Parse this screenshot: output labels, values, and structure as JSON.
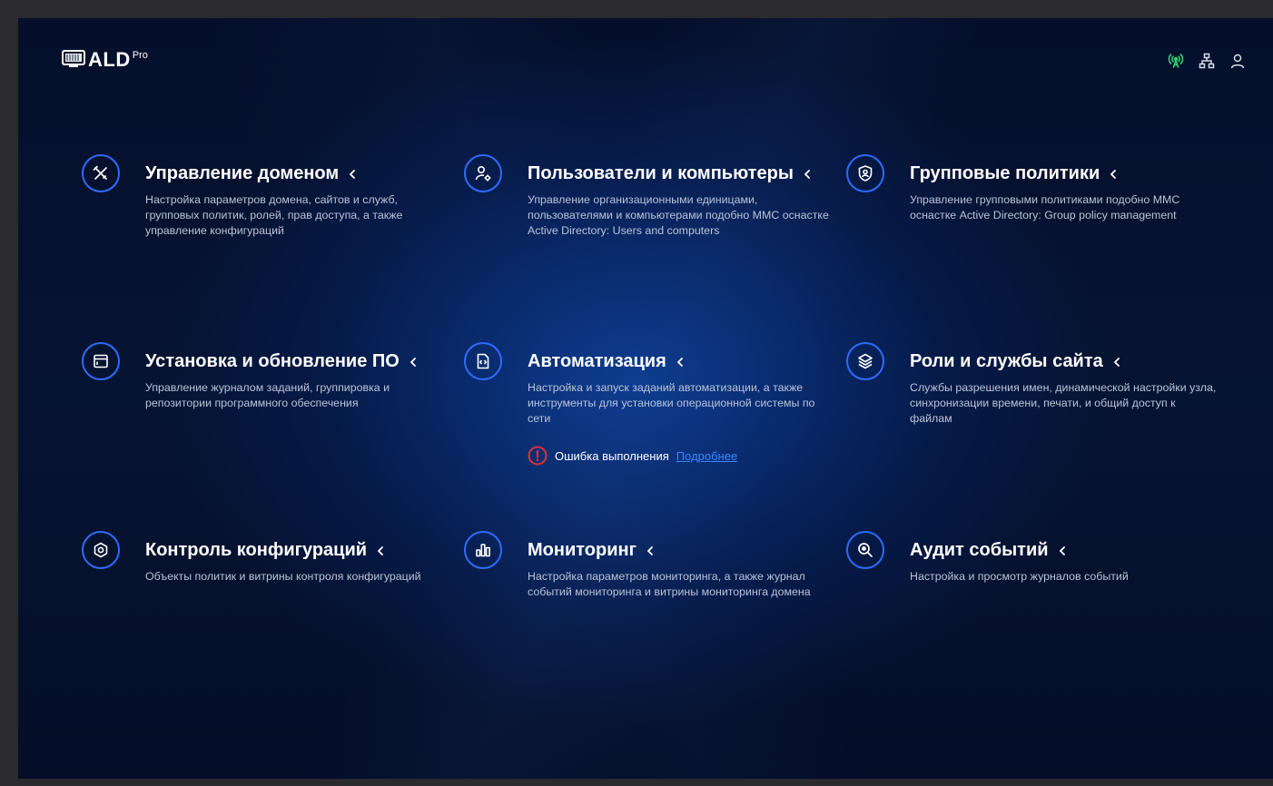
{
  "brand": {
    "name": "ALD",
    "suffix": "Pro"
  },
  "header_icons": [
    {
      "icon": "signal-icon",
      "color": "#3bd16f"
    },
    {
      "icon": "network-icon",
      "color": "#d7deea"
    },
    {
      "icon": "user-icon",
      "color": "#d7deea"
    }
  ],
  "colors": {
    "accent": "#2f6bff",
    "error": "#e0303a",
    "link": "#3a86ff"
  },
  "cards": [
    {
      "title": "Управление доменом",
      "description": "Настройка параметров домена, сайтов и служб, групповых политик, ролей, прав доступа, а также управление конфигураций",
      "icon": "tools-icon"
    },
    {
      "title": "Пользователи и компьютеры",
      "description": "Управление организационными единицами, пользователями и компьютерами подобно MMC оснастке Active Directory: Users and computers",
      "icon": "user-gear-icon"
    },
    {
      "title": "Групповые политики",
      "description": "Управление групповыми политиками подобно MMC оснастке Active Directory: Group policy management",
      "icon": "shield-user-icon"
    },
    {
      "title": "Установка и обновление ПО",
      "description": "Управление журналом заданий, группировка и репозитории программного обеспечения",
      "icon": "window-icon"
    },
    {
      "title": "Автоматизация",
      "description": "Настройка и запуск заданий автоматизации, а также инструменты для установки операционной системы по сети",
      "icon": "code-file-icon",
      "error": {
        "text": "Ошибка выполнения",
        "link": "Подробнее"
      }
    },
    {
      "title": "Роли и службы сайта",
      "description": "Службы разрешения имен, динамической настройки узла, синхронизации времени, печати, и общий доступ к файлам",
      "icon": "layers-icon"
    },
    {
      "title": "Контроль конфигураций",
      "description": "Объекты политик и витрины контроля конфигураций",
      "icon": "settings-icon"
    },
    {
      "title": "Мониторинг",
      "description": "Настройка параметров мониторинга, а также журнал событий мониторинга и витрины мониторинга домена",
      "icon": "bar-chart-icon"
    },
    {
      "title": "Аудит событий",
      "description": "Настройка и просмотр журналов событий",
      "icon": "search-zoom-icon"
    }
  ]
}
